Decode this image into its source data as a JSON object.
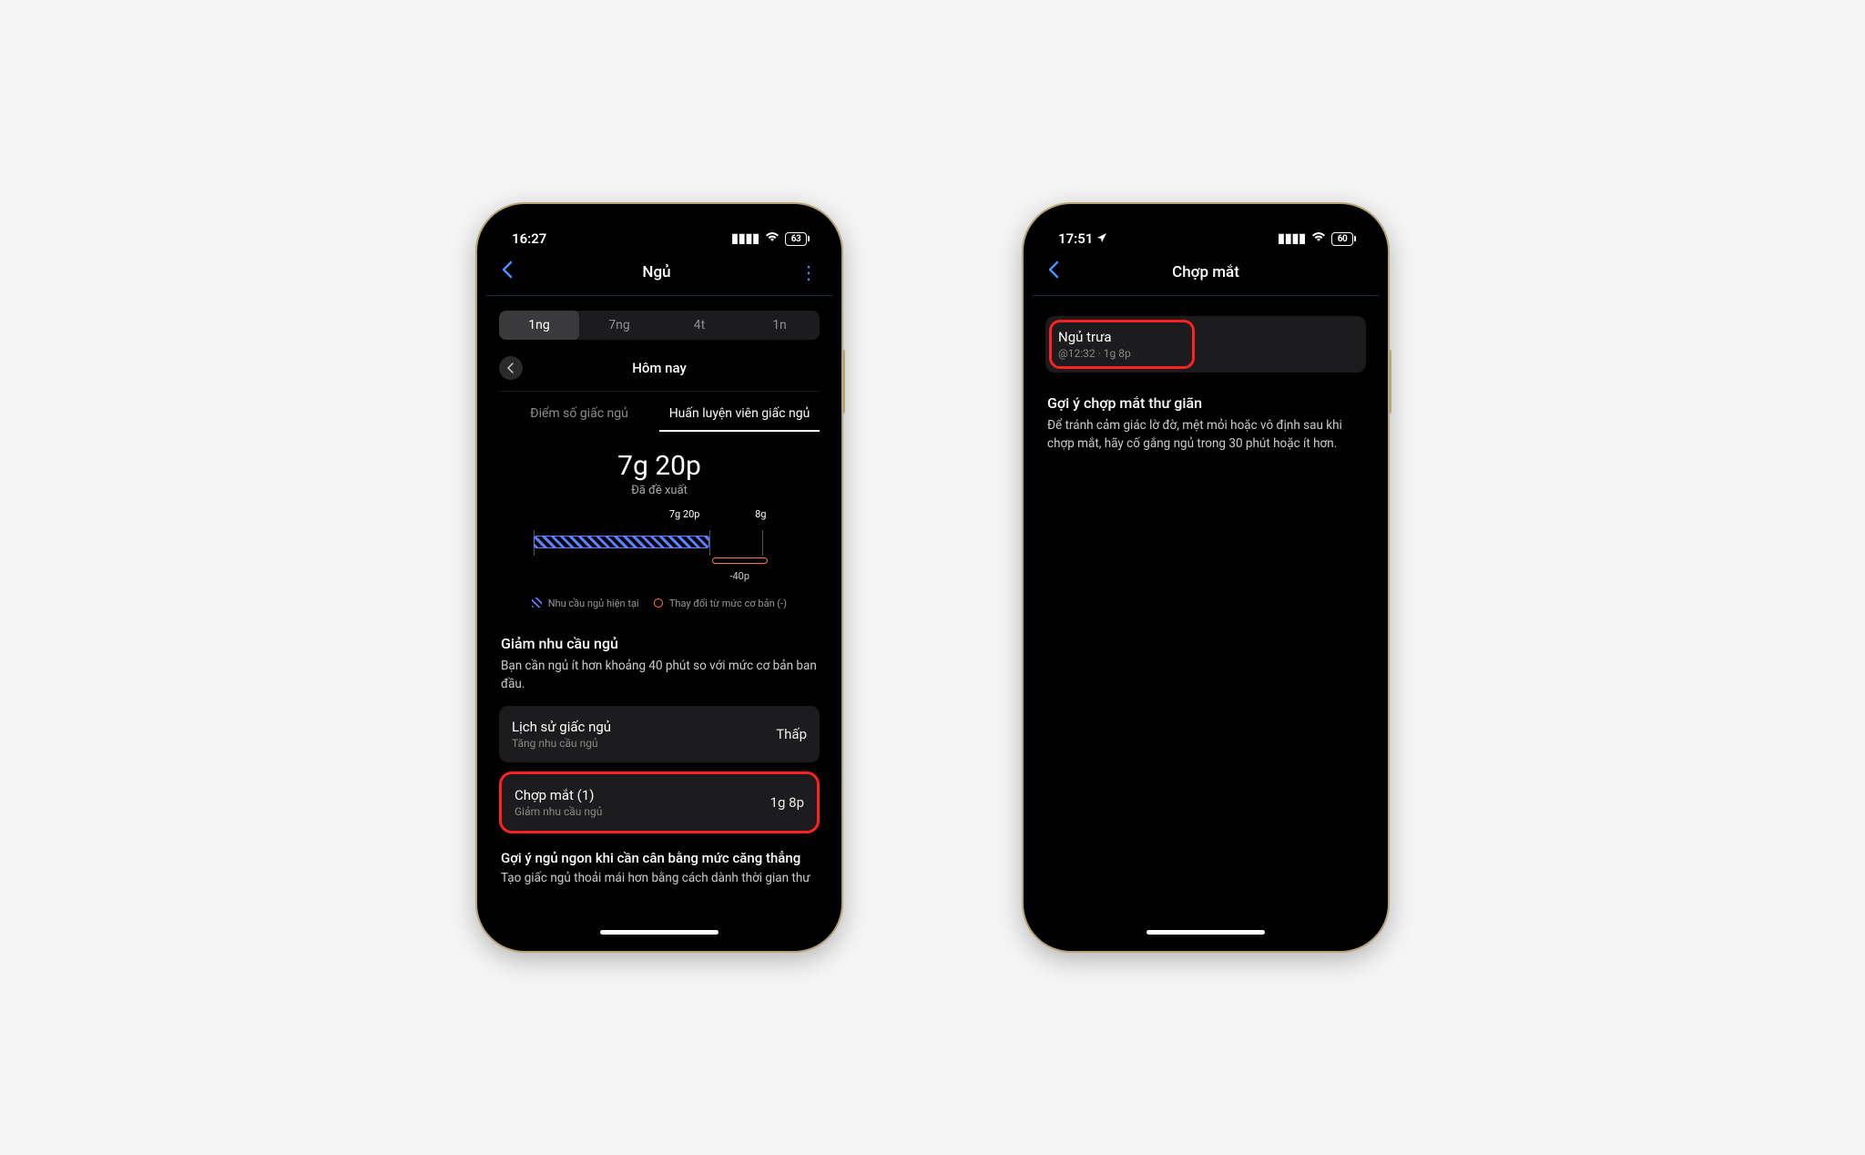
{
  "phone1": {
    "status": {
      "time": "16:27",
      "battery": "63"
    },
    "nav": {
      "title": "Ngủ"
    },
    "segments": [
      "1ng",
      "7ng",
      "4t",
      "1n"
    ],
    "segment_active_index": 0,
    "day_label": "Hôm nay",
    "tabs": [
      "Điểm số giấc ngủ",
      "Huấn luyện viên giấc ngủ"
    ],
    "tab_active_index": 1,
    "suggested": {
      "value": "7g 20p",
      "label": "Đã đề xuất"
    },
    "chart": {
      "label_current": "7g 20p",
      "label_target": "8g",
      "delta_label": "-40p"
    },
    "legend": {
      "current": "Nhu cầu ngủ hiện tại",
      "change": "Thay đổi từ mức cơ bản (-)"
    },
    "section1": {
      "title": "Giảm nhu cầu ngủ",
      "body": "Bạn cần ngủ ít hơn khoảng 40 phút so với mức cơ bản ban đầu."
    },
    "cards": [
      {
        "title": "Lịch sử giấc ngủ",
        "sub": "Tăng nhu cầu ngủ",
        "value": "Thấp"
      },
      {
        "title": "Chợp mắt (1)",
        "sub": "Giảm nhu cầu ngủ",
        "value": "1g 8p"
      }
    ],
    "tip_title": "Gợi ý ngủ ngon khi cần cân bằng mức căng thẳng",
    "tip_body": "Tạo giấc ngủ thoải mái hơn bằng cách dành thời gian thư"
  },
  "phone2": {
    "status": {
      "time": "17:51",
      "battery": "60"
    },
    "nav": {
      "title": "Chợp mắt"
    },
    "nap": {
      "title": "Ngủ trưa",
      "sub": "@12:32  ·  1g 8p"
    },
    "tip_title": "Gợi ý chợp mắt thư giãn",
    "tip_body": "Để tránh cảm giác lờ đờ, mệt mỏi hoặc vô định sau khi chợp mắt, hãy cố gắng ngủ trong 30 phút hoặc ít hơn."
  },
  "chart_data": {
    "type": "bar",
    "description": "Sleep need horizontal bar: current suggested sleep vs baseline",
    "baseline_hours": 8.0,
    "current_hours": 7.33,
    "delta_minutes": -40,
    "labels": {
      "current": "7g 20p",
      "baseline": "8g",
      "delta": "-40p"
    },
    "series": [
      {
        "name": "Nhu cầu ngủ hiện tại",
        "value": 7.33
      },
      {
        "name": "Thay đổi từ mức cơ bản (-)",
        "value": -0.67
      }
    ]
  }
}
